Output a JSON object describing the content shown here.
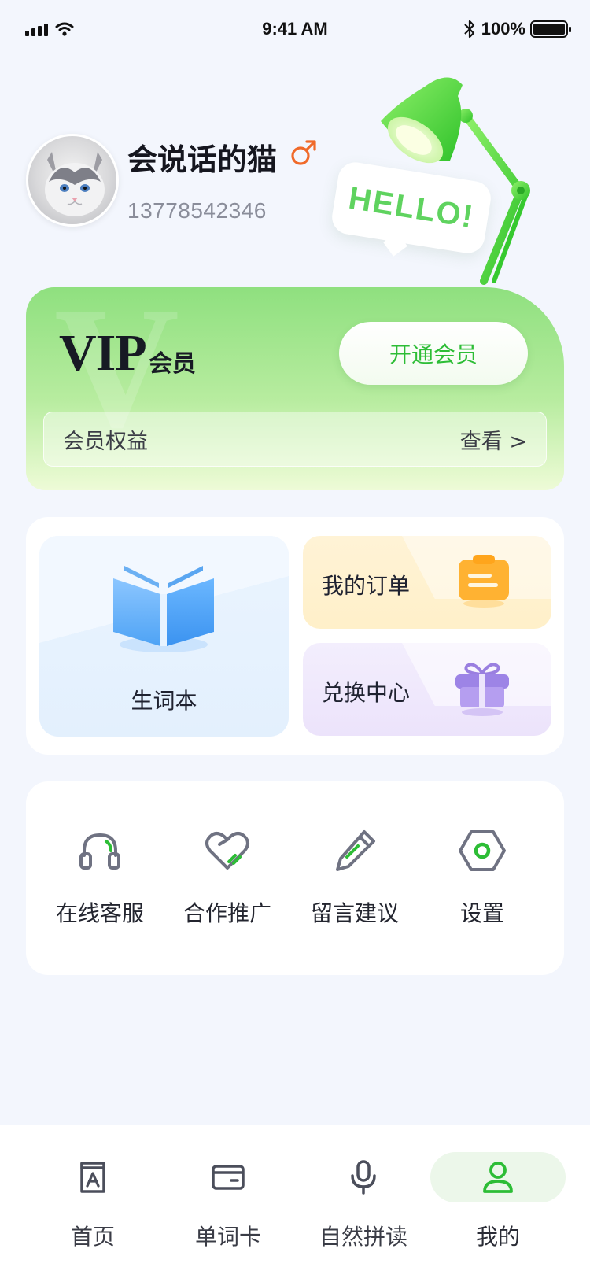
{
  "status_bar": {
    "time": "9:41 AM",
    "battery": "100%"
  },
  "profile": {
    "username": "会说话的猫",
    "gender_symbol": "♂",
    "phone": "13778542346",
    "greeting": "HELLO!"
  },
  "vip": {
    "title": "VIP",
    "subtitle": "会员",
    "open_button": "开通会员",
    "benefits_label": "会员权益",
    "benefits_link": "查看 >"
  },
  "quick": {
    "wordbook": "生词本",
    "orders": "我的订单",
    "exchange": "兑换中心"
  },
  "services": [
    {
      "label": "在线客服",
      "icon": "headset-icon"
    },
    {
      "label": "合作推广",
      "icon": "handshake-heart-icon"
    },
    {
      "label": "留言建议",
      "icon": "pencil-icon"
    },
    {
      "label": "设置",
      "icon": "settings-hexagon-icon"
    }
  ],
  "tabs": [
    {
      "label": "首页",
      "icon": "home-book-icon",
      "active": false
    },
    {
      "label": "单词卡",
      "icon": "card-icon",
      "active": false
    },
    {
      "label": "自然拼读",
      "icon": "microphone-icon",
      "active": false
    },
    {
      "label": "我的",
      "icon": "user-icon",
      "active": true
    }
  ],
  "colors": {
    "accent_green": "#2dbd36",
    "background": "#f3f6fd",
    "order_bg": "#fff0c9",
    "exchange_bg": "#ece3fb",
    "icon_gray": "#6f7282"
  }
}
